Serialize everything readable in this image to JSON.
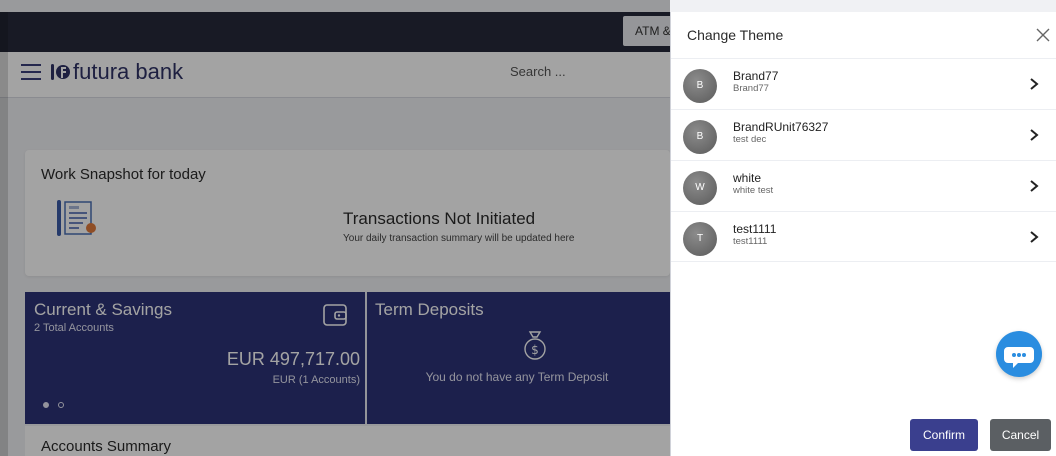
{
  "header": {
    "atm_label": "ATM &",
    "brand": "futura bank",
    "search_placeholder": "Search ..."
  },
  "snapshot": {
    "title": "Work Snapshot for today",
    "status_title": "Transactions Not Initiated",
    "status_sub": "Your daily transaction summary will be updated here"
  },
  "current_savings": {
    "title": "Current & Savings",
    "count": "2 Total Accounts",
    "amount": "EUR 497,717.00",
    "amount_sub": "EUR (1 Accounts)"
  },
  "term_deposits": {
    "title": "Term Deposits",
    "empty": "You do not have any Term Deposit"
  },
  "summary": {
    "title": "Accounts Summary"
  },
  "drawer": {
    "title": "Change Theme",
    "items": [
      {
        "initial": "B",
        "name": "Brand77",
        "desc": "Brand77"
      },
      {
        "initial": "B",
        "name": "BrandRUnit76327",
        "desc": "test dec"
      },
      {
        "initial": "W",
        "name": "white",
        "desc": "white test"
      },
      {
        "initial": "T",
        "name": "test1111",
        "desc": "test1111"
      }
    ],
    "confirm_label": "Confirm",
    "cancel_label": "Cancel"
  },
  "colors": {
    "primary": "#3a3f8e",
    "accounts_bg": "#2d3377",
    "chat": "#2a8de0",
    "cancel": "#5b5f63"
  }
}
